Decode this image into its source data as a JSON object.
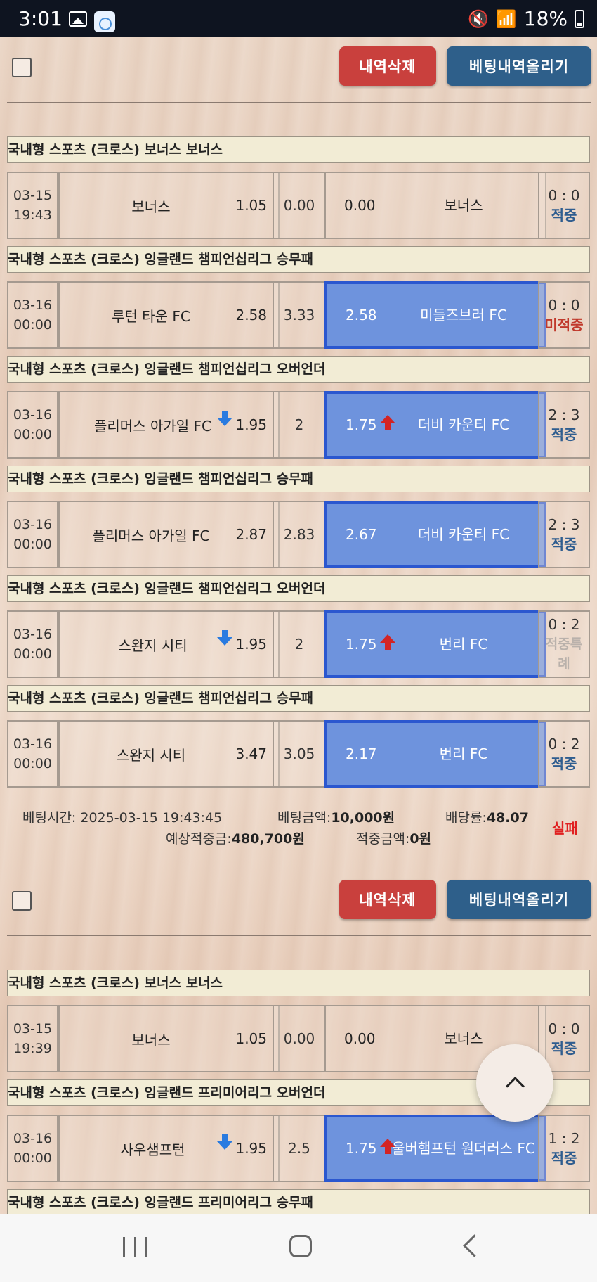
{
  "status_bar": {
    "time": "3:01",
    "battery": "18%"
  },
  "labels": {
    "delete": "내역삭제",
    "upload": "베팅내역올리기"
  },
  "slips": [
    {
      "games": [
        {
          "header": "국내형 스포츠 (크로스)  보너스  보너스",
          "date": "03-15",
          "time": "19:43",
          "home": "보너스",
          "home_odds": "1.05",
          "draw": "0.00",
          "away_odds": "0.00",
          "away": "보너스",
          "score": "0 : 0",
          "result": "적중",
          "selected": "none"
        },
        {
          "header": "국내형 스포츠 (크로스)  잉글랜드 챔피언십리그  승무패",
          "date": "03-16",
          "time": "00:00",
          "home": "루턴 타운 FC",
          "home_odds": "2.58",
          "draw": "3.33",
          "away_odds": "2.58",
          "away": "미들즈브러 FC",
          "score": "0 : 0",
          "result": "미적중",
          "selected": "away"
        },
        {
          "header": "국내형 스포츠 (크로스)  잉글랜드 챔피언십리그  오버언더",
          "date": "03-16",
          "time": "00:00",
          "home": "플리머스 아가일 FC",
          "home_odds": "1.95",
          "draw": "2",
          "away_odds": "1.75",
          "away": "더비 카운티 FC",
          "score": "2 : 3",
          "result": "적중",
          "selected": "away",
          "ou": true
        },
        {
          "header": "국내형 스포츠 (크로스)  잉글랜드 챔피언십리그  승무패",
          "date": "03-16",
          "time": "00:00",
          "home": "플리머스 아가일 FC",
          "home_odds": "2.87",
          "draw": "2.83",
          "away_odds": "2.67",
          "away": "더비 카운티 FC",
          "score": "2 : 3",
          "result": "적중",
          "selected": "away"
        },
        {
          "header": "국내형 스포츠 (크로스)  잉글랜드 챔피언십리그  오버언더",
          "date": "03-16",
          "time": "00:00",
          "home": "스완지 시티",
          "home_odds": "1.95",
          "draw": "2",
          "away_odds": "1.75",
          "away": "번리 FC",
          "score": "0 : 2",
          "result": "적중특례",
          "selected": "away",
          "ou": true
        },
        {
          "header": "국내형 스포츠 (크로스)  잉글랜드 챔피언십리그  승무패",
          "date": "03-16",
          "time": "00:00",
          "home": "스완지 시티",
          "home_odds": "3.47",
          "draw": "3.05",
          "away_odds": "2.17",
          "away": "번리 FC",
          "score": "0 : 2",
          "result": "적중",
          "selected": "away"
        }
      ],
      "summary": {
        "bet_time_label": "베팅시간:",
        "bet_time": "2025-03-15 19:43:45",
        "bet_amount_label": "베팅금액:",
        "bet_amount": "10,000원",
        "odds_label": "배당률:",
        "odds": "48.07",
        "expected_label": "예상적중금:",
        "expected": "480,700원",
        "won_label": "적중금액:",
        "won": "0원",
        "status": "실패"
      }
    },
    {
      "games": [
        {
          "header": "국내형 스포츠 (크로스)  보너스  보너스",
          "date": "03-15",
          "time": "19:39",
          "home": "보너스",
          "home_odds": "1.05",
          "draw": "0.00",
          "away_odds": "0.00",
          "away": "보너스",
          "score": "0 : 0",
          "result": "적중",
          "selected": "none"
        },
        {
          "header": "국내형 스포츠 (크로스)  잉글랜드 프리미어리그  오버언더",
          "date": "03-16",
          "time": "00:00",
          "home": "사우샘프턴",
          "home_odds": "1.95",
          "draw": "2.5",
          "away_odds": "1.75",
          "away": "울버햄프턴 원더러스 FC",
          "score": "1 : 2",
          "result": "적중",
          "selected": "away",
          "ou": true
        }
      ],
      "partial_header": "국내형 스포츠 (크로스)  잉글랜드 프리미어리그  승무패"
    }
  ],
  "colors": {
    "delete_btn": "#c9403d",
    "upload_btn": "#2e5f8a",
    "selected_cell": "#6e93dd",
    "win": "#2f5d8f",
    "lose": "#c0392b",
    "fail": "#e02020"
  }
}
